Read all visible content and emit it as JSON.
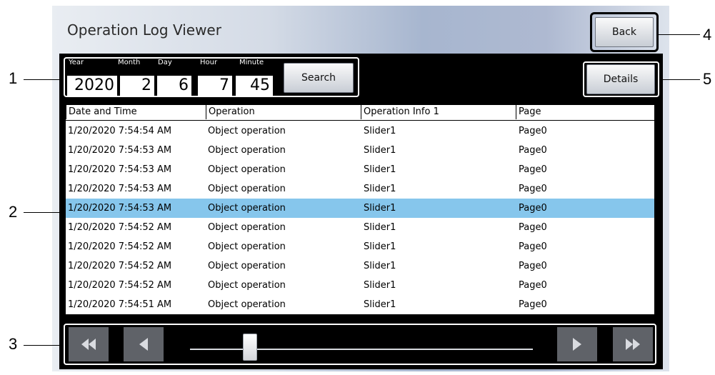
{
  "window": {
    "title": "Operation Log Viewer",
    "back_label": "Back",
    "details_label": "Details"
  },
  "search": {
    "fields": [
      {
        "label": "Year",
        "value": "2020"
      },
      {
        "label": "Month",
        "value": "2"
      },
      {
        "label": "Day",
        "value": "6"
      },
      {
        "label": "Hour",
        "value": "7"
      },
      {
        "label": "Minute",
        "value": "45"
      }
    ],
    "button_label": "Search"
  },
  "table": {
    "columns": [
      "Date and Time",
      "Operation",
      "Operation Info 1",
      "Page"
    ],
    "rows": [
      [
        "1/20/2020 7:54:54 AM",
        "Object operation",
        "Slider1",
        "Page0"
      ],
      [
        "1/20/2020 7:54:53 AM",
        "Object operation",
        "Slider1",
        "Page0"
      ],
      [
        "1/20/2020 7:54:53 AM",
        "Object operation",
        "Slider1",
        "Page0"
      ],
      [
        "1/20/2020 7:54:53 AM",
        "Object operation",
        "Slider1",
        "Page0"
      ],
      [
        "1/20/2020 7:54:53 AM",
        "Object operation",
        "Slider1",
        "Page0"
      ],
      [
        "1/20/2020 7:54:52 AM",
        "Object operation",
        "Slider1",
        "Page0"
      ],
      [
        "1/20/2020 7:54:52 AM",
        "Object operation",
        "Slider1",
        "Page0"
      ],
      [
        "1/20/2020 7:54:52 AM",
        "Object operation",
        "Slider1",
        "Page0"
      ],
      [
        "1/20/2020 7:54:52 AM",
        "Object operation",
        "Slider1",
        "Page0"
      ],
      [
        "1/20/2020 7:54:51 AM",
        "Object operation",
        "Slider1",
        "Page0"
      ]
    ],
    "selected_row": 4
  },
  "scrollbar": {
    "first_icon": "double-left-arrow-icon",
    "prev_icon": "left-arrow-icon",
    "next_icon": "right-arrow-icon",
    "last_icon": "double-right-arrow-icon",
    "position": 0.16
  },
  "annotations": [
    "1",
    "2",
    "3",
    "4",
    "5"
  ],
  "colors": {
    "selected_row": "#86c6ec",
    "panel": "#000000"
  }
}
